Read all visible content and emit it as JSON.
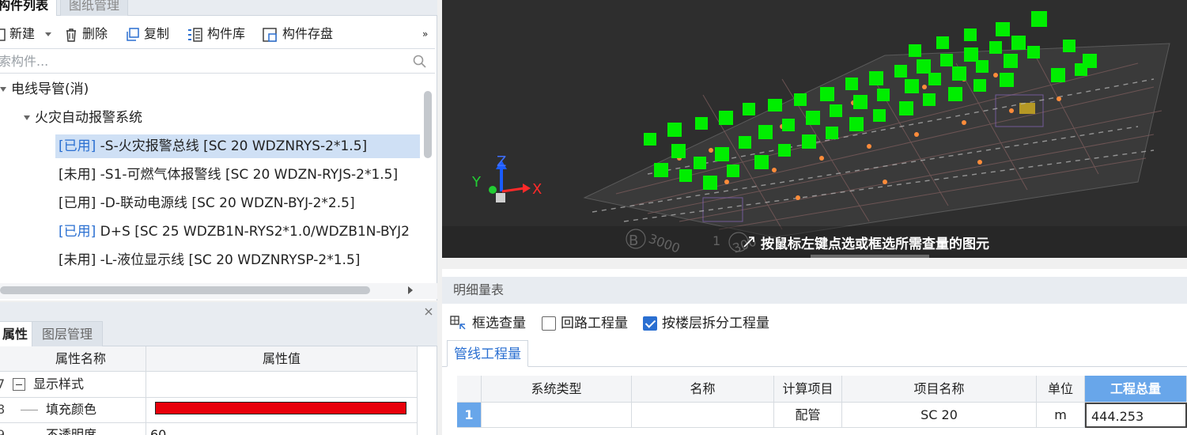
{
  "component_panel": {
    "tabs": [
      {
        "label": "构件列表"
      },
      {
        "label": "图纸管理"
      }
    ],
    "toolbar": {
      "new_label": "新建",
      "delete_label": "删除",
      "copy_label": "复制",
      "library_label": "构件库",
      "save_label": "构件存盘",
      "more_glyph": "»"
    },
    "search": {
      "placeholder": "索构件..."
    },
    "tree": {
      "root_label": "电线导管(消)",
      "group_label": "火灾自动报警系统",
      "items": [
        {
          "tag": "[已用]",
          "text": " -S-火灾报警总线 [SC 20 WDZNRYS-2*1.5]"
        },
        {
          "tag": "[未用]",
          "text": " -S1-可燃气体报警线 [SC 20 WDZN-RYJS-2*1.5]"
        },
        {
          "tag": "[已用]",
          "text": " -D-联动电源线 [SC 20 WDZN-BYJ-2*2.5]"
        },
        {
          "tag": "[已用]",
          "text": " D+S [SC 25 WDZB1N-RYS2*1.0/WDZB1N-BYJ2"
        },
        {
          "tag": "[未用]",
          "text": " -L-液位显示线 [SC 20 WDZNRYSP-2*1.5]"
        }
      ]
    }
  },
  "property_panel": {
    "tabs": [
      {
        "label": "属性"
      },
      {
        "label": "图层管理"
      }
    ],
    "headers": {
      "name": "属性名称",
      "value": "属性值"
    },
    "rows": [
      {
        "num": "7",
        "name": "显示样式",
        "value": ""
      },
      {
        "num": "8",
        "name": "填充颜色",
        "value": ""
      },
      {
        "num": "9",
        "name": "不透明度",
        "value": "60"
      }
    ],
    "fill_color": "#e8000b"
  },
  "viewport": {
    "hint": "按鼠标左键点选或框选所需查量的图元",
    "axis_labels": {
      "x": "X",
      "y": "Y",
      "z": "Z"
    },
    "overlay_marks": [
      "B",
      "3000",
      "1",
      "300"
    ],
    "colors": {
      "background": "#2e2e2e",
      "element": "#00ee00"
    }
  },
  "detail": {
    "title": "明细量表",
    "tools": {
      "frame_select": "框选查量",
      "loop_qty": "回路工程量",
      "loop_checked": false,
      "split_floor": "按楼层拆分工程量",
      "split_checked": true
    },
    "tab": "管线工程量",
    "columns": [
      "系统类型",
      "名称",
      "计算项目",
      "项目名称",
      "单位",
      "工程总量"
    ],
    "rows": [
      {
        "num": "1",
        "system": "",
        "name": "",
        "calc": "配管",
        "item": "SC 20",
        "unit": "m",
        "total": "444.253"
      }
    ]
  }
}
